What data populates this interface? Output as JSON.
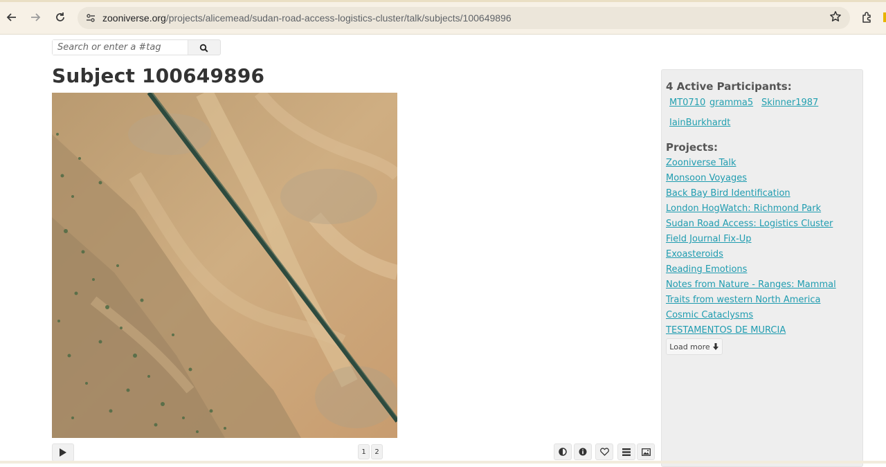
{
  "browser": {
    "url_host": "zooniverse.org",
    "url_path": "/projects/alicemead/sudan-road-access-logistics-cluster/talk/subjects/100649896",
    "icons": [
      "back-icon",
      "forward-icon",
      "reload-icon",
      "site-settings-icon",
      "star-icon",
      "extensions-icon"
    ]
  },
  "search": {
    "placeholder": "Search or enter a #tag",
    "icon": "search-icon"
  },
  "subject": {
    "title": "Subject 100649896",
    "frames": [
      "1",
      "2"
    ]
  },
  "toolbar": {
    "buttons": [
      "invert-icon",
      "info-icon",
      "favorite-icon",
      "collections-icon",
      "image-icon"
    ]
  },
  "sidebar": {
    "participants_heading": "4 Active Participants:",
    "participants": [
      "MT0710",
      "gramma5",
      "Skinner1987",
      "IainBurkhardt"
    ],
    "projects_heading": "Projects:",
    "projects": [
      "Zooniverse Talk",
      "Monsoon Voyages",
      "Back Bay Bird Identification",
      "London HogWatch: Richmond Park ",
      "Sudan Road Access: Logistics Cluster",
      "Field Journal Fix-Up",
      "Exoasteroids",
      "Reading Emotions",
      "Notes from Nature - Ranges: Mammal ",
      "Traits from western North America",
      "Cosmic Cataclysms ",
      "TESTAMENTOS DE MURCIA"
    ],
    "load_more": "Load more"
  },
  "colors": {
    "link": "#1f9cb0",
    "heading": "#555555",
    "sidebar_bg": "#eeeeee",
    "chrome_bg": "#f7f1e6"
  }
}
